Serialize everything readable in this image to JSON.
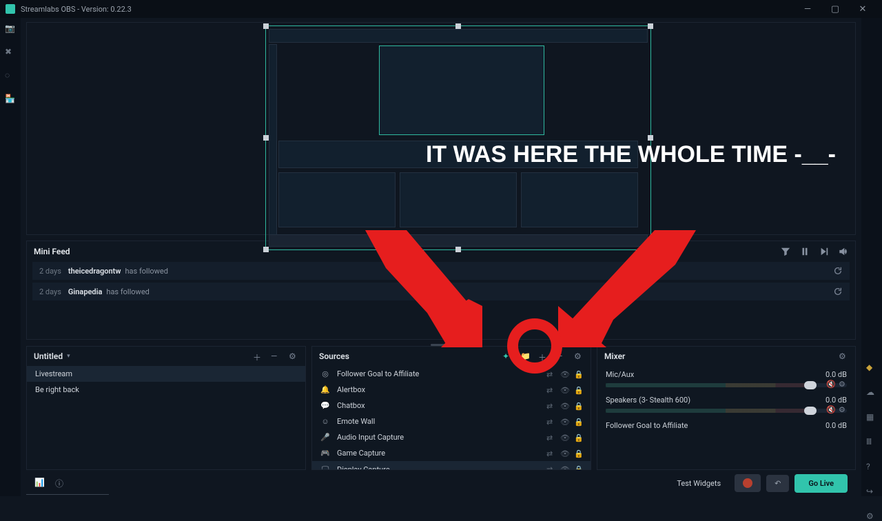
{
  "titlebar": {
    "text": "Streamlabs OBS - Version: 0.22.3"
  },
  "overlay": {
    "text": "IT WAS HERE THE WHOLE TIME -__-"
  },
  "minifeed": {
    "title": "Mini Feed",
    "items": [
      {
        "when": "2 days",
        "who": "theicedragontw",
        "what": "has followed"
      },
      {
        "when": "2 days",
        "who": "Ginapedia",
        "what": "has followed"
      }
    ]
  },
  "scenes": {
    "title": "Untitled",
    "items": [
      {
        "label": "Livestream",
        "selected": true
      },
      {
        "label": "Be right back",
        "selected": false
      }
    ]
  },
  "sources": {
    "title": "Sources",
    "items": [
      {
        "icon": "◎",
        "label": "Follower Goal to Affiliate",
        "selected": false
      },
      {
        "icon": "🔔",
        "label": "Alertbox",
        "selected": false
      },
      {
        "icon": "💬",
        "label": "Chatbox",
        "selected": false
      },
      {
        "icon": "☺",
        "label": "Emote Wall",
        "selected": false
      },
      {
        "icon": "🎤",
        "label": "Audio Input Capture",
        "selected": false
      },
      {
        "icon": "🎮",
        "label": "Game Capture",
        "selected": false
      },
      {
        "icon": "🖵",
        "label": "Display Capture",
        "selected": true
      }
    ]
  },
  "mixer": {
    "title": "Mixer",
    "items": [
      {
        "name": "Mic/Aux",
        "db": "0.0 dB",
        "bar": true
      },
      {
        "name": "Speakers (3- Stealth 600)",
        "db": "0.0 dB",
        "bar": true
      },
      {
        "name": "Follower Goal to Affiliate",
        "db": "0.0 dB",
        "bar": false
      }
    ]
  },
  "footer": {
    "test_widgets": "Test Widgets",
    "rec": "REC",
    "go_live": "Go Live"
  }
}
